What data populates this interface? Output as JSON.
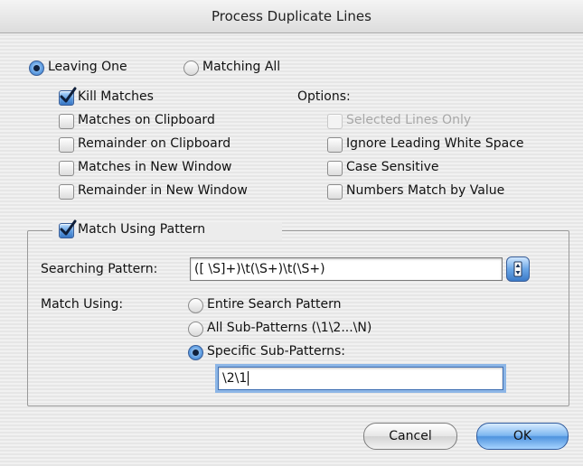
{
  "window": {
    "title": "Process Duplicate Lines"
  },
  "mode": {
    "leaving_one": "Leaving One",
    "matching_all": "Matching All",
    "selected": "leaving_one"
  },
  "left_options": {
    "kill_matches": {
      "label": "Kill Matches",
      "checked": true
    },
    "matches_on_clipboard": {
      "label": "Matches on Clipboard",
      "checked": false
    },
    "remainder_on_clipboard": {
      "label": "Remainder on Clipboard",
      "checked": false
    },
    "matches_in_new_window": {
      "label": "Matches in New Window",
      "checked": false
    },
    "remainder_in_new_window": {
      "label": "Remainder in New Window",
      "checked": false
    }
  },
  "options": {
    "heading": "Options:",
    "selected_lines_only": {
      "label": "Selected Lines Only",
      "checked": false,
      "enabled": false
    },
    "ignore_leading_white_space": {
      "label": "Ignore Leading White Space",
      "checked": false
    },
    "case_sensitive": {
      "label": "Case Sensitive",
      "checked": false
    },
    "numbers_match_by_value": {
      "label": "Numbers Match by Value",
      "checked": false
    }
  },
  "pattern_group": {
    "match_using_pattern": {
      "label": "Match Using Pattern",
      "checked": true
    },
    "searching_pattern_label": "Searching Pattern:",
    "searching_pattern_value": "([ \\S]+)\\t(\\S+)\\t(\\S+)",
    "match_using_label": "Match Using:",
    "entire_search_pattern": "Entire Search Pattern",
    "all_sub_patterns": "All Sub-Patterns (\\1\\2...\\N)",
    "specific_sub_patterns": "Specific Sub-Patterns:",
    "selected": "specific_sub_patterns",
    "sub_patterns_value": "\\2\\1"
  },
  "buttons": {
    "cancel": "Cancel",
    "ok": "OK"
  },
  "colors": {
    "accent": "#5c9be0",
    "focus_ring": "#8db6e6"
  }
}
